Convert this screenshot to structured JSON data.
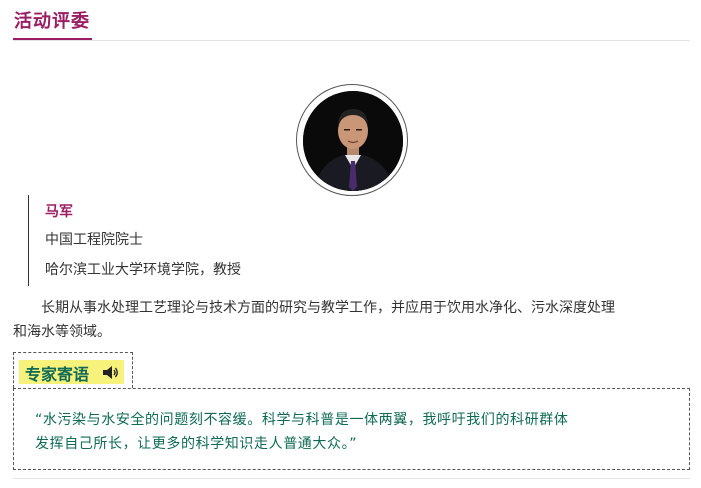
{
  "section": {
    "title": "活动评委"
  },
  "judge": {
    "name": "马军",
    "title_line1": "中国工程院院士",
    "title_line2": "哈尔滨工业大学环境学院，教授"
  },
  "description": {
    "line1": "长期从事水处理工艺理论与技术方面的研究与教学工作，并应用于饮用水净化、污水深度处理",
    "line2": "和海水等领域。"
  },
  "expert_message": {
    "label": "专家寄语",
    "quote_line1": "“水污染与水安全的问题刻不容缓。科学与科普是一体两翼，我呼吁我们的科研群体",
    "quote_line2": "发挥自己所长，让更多的科学知识走人普通大众。”"
  },
  "colors": {
    "accent": "#9b1e64",
    "quote_text": "#0e6a55",
    "highlight": "#f6f27b"
  },
  "icons": {
    "speaker": "speaker-icon"
  }
}
